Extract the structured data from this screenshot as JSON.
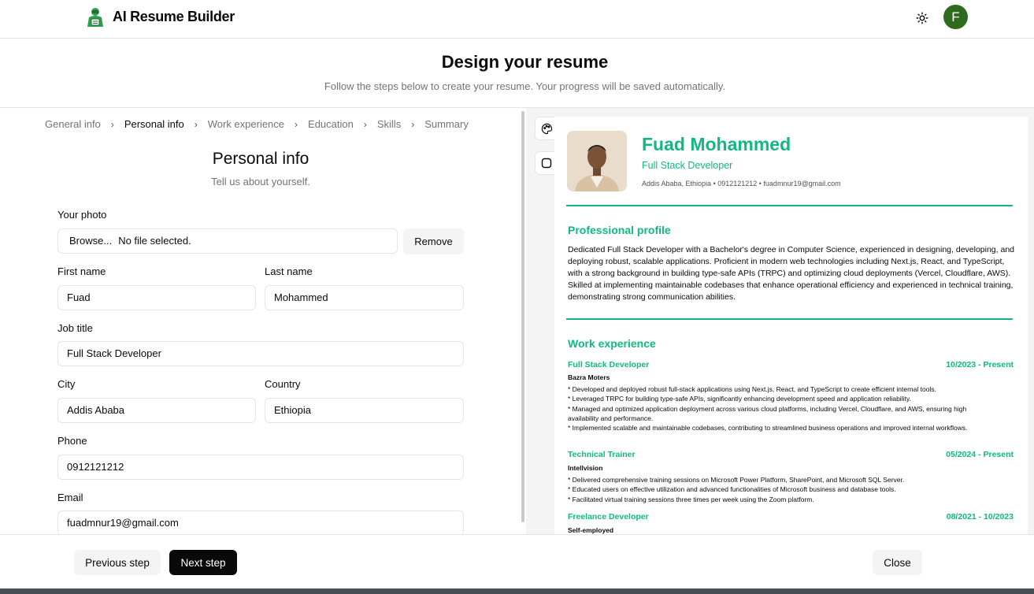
{
  "app": {
    "title": "AI Resume Builder",
    "avatar_initial": "F",
    "brand_color": "#2e6b1f"
  },
  "header": {
    "title": "Design your resume",
    "subtitle": "Follow the steps below to create your resume. Your progress will be saved automatically."
  },
  "breadcrumb": [
    {
      "label": "General info",
      "active": false
    },
    {
      "label": "Personal info",
      "active": true
    },
    {
      "label": "Work experience",
      "active": false
    },
    {
      "label": "Education",
      "active": false
    },
    {
      "label": "Skills",
      "active": false
    },
    {
      "label": "Summary",
      "active": false
    }
  ],
  "form": {
    "title": "Personal info",
    "subtitle": "Tell us about yourself.",
    "photo_label": "Your photo",
    "browse_label": "Browse...",
    "file_status": "No file selected.",
    "remove_label": "Remove",
    "first_name_label": "First name",
    "first_name": "Fuad",
    "last_name_label": "Last name",
    "last_name": "Mohammed",
    "job_title_label": "Job title",
    "job_title": "Full Stack Developer",
    "city_label": "City",
    "city": "Addis Ababa",
    "country_label": "Country",
    "country": "Ethiopia",
    "phone_label": "Phone",
    "phone": "0912121212",
    "email_label": "Email",
    "email": "fuadmnur19@gmail.com"
  },
  "preview": {
    "accent_color": "#10b981",
    "name": "Fuad Mohammed",
    "job_title": "Full Stack Developer",
    "contact": "Addis Ababa, Ethiopia • 0912121212 • fuadmnur19@gmail.com",
    "profile_heading": "Professional profile",
    "profile_text": "Dedicated Full Stack Developer with a Bachelor's degree in Computer Science, experienced in designing, developing, and deploying robust, scalable applications. Proficient in modern web technologies including Next.js, React, and TypeScript, with a strong background in building type-safe APIs (TRPC) and optimizing cloud deployments (Vercel, Cloudflare, AWS). Skilled at implementing maintainable codebases that enhance operational efficiency and experienced in technical training, demonstrating strong communication abilities.",
    "work_heading": "Work experience",
    "jobs": [
      {
        "position": "Full Stack Developer",
        "dates": "10/2023 - Present",
        "company": "Bazra Moters",
        "description": "* Developed and deployed robust full-stack applications using Next.js, React, and TypeScript to create efficient internal tools.\n* Leveraged TRPC for building type-safe APIs, significantly enhancing development speed and application reliability.\n* Managed and optimized application deployment across various cloud platforms, including Vercel, Cloudflare, and AWS, ensuring high availability and performance.\n* Implemented scalable and maintainable codebases, contributing to streamlined business operations and improved internal workflows."
      },
      {
        "position": "Technical Trainer",
        "dates": "05/2024 - Present",
        "company": "Intellvision",
        "description": "* Delivered comprehensive training sessions on Microsoft Power Platform, SharePoint, and Microsoft SQL Server.\n* Educated users on effective utilization and advanced functionalities of Microsoft business and database tools.\n* Facilitated virtual training sessions three times per week using the Zoom platform."
      },
      {
        "position": "Freelance Developer",
        "dates": "08/2021 - 10/2023",
        "company": "Self-employed",
        "description": ""
      }
    ]
  },
  "footer": {
    "previous_label": "Previous step",
    "next_label": "Next step",
    "close_label": "Close"
  },
  "icons": {
    "theme": "sun-icon",
    "color_picker": "palette-icon",
    "border_style": "square-icon",
    "logo": "robot-logo-icon"
  }
}
